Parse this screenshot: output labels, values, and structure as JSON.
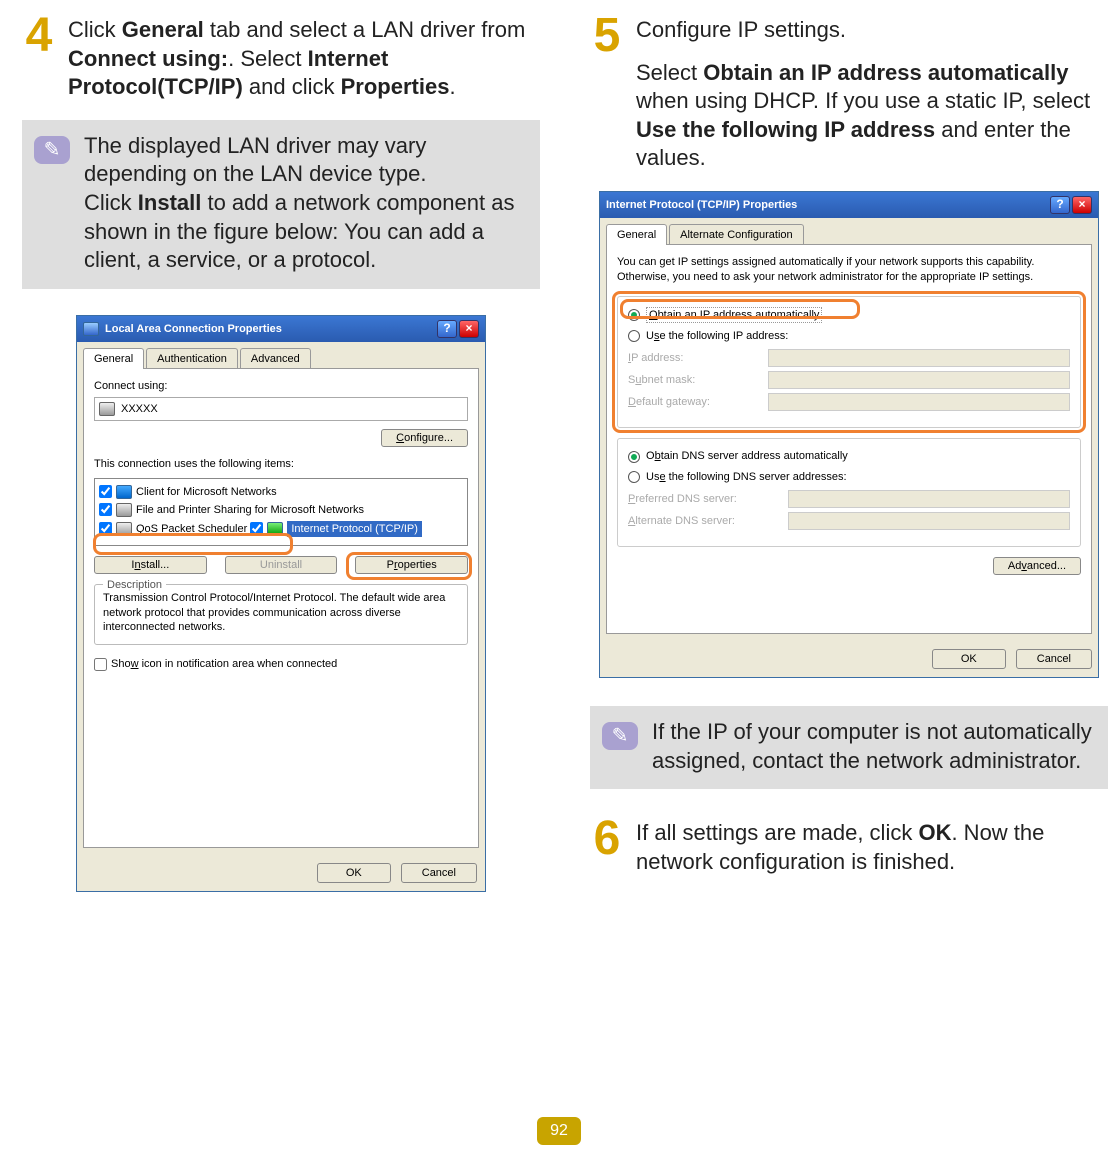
{
  "steps": {
    "s4": {
      "num": "4",
      "text_pre": "Click ",
      "b1": "General",
      "text_mid1": " tab and select a LAN driver from ",
      "b2": "Connect using:",
      "text_mid2": ". Select ",
      "b3": "Internet Protocol(TCP/IP)",
      "text_mid3": " and click ",
      "b4": "Properties",
      "text_end": "."
    },
    "s5": {
      "num": "5",
      "line1": "Configure IP settings.",
      "para_pre": "Select ",
      "b1": "Obtain an IP address automatically",
      "para_mid1": " when using DHCP. If you use a static IP, select ",
      "b2": "Use the following IP address",
      "para_mid2": " and enter the values."
    },
    "s6": {
      "num": "6",
      "text_pre": "If all settings are made, click ",
      "b1": "OK",
      "text_end": ". Now the network configuration is finished."
    }
  },
  "notes": {
    "n1": {
      "p1": "The displayed LAN driver may vary depending on the LAN device type.",
      "p2_pre": "Click ",
      "p2_b": "Install",
      "p2_post": " to add a network component as shown in the figure below: You can add a client, a service, or a protocol."
    },
    "n2": {
      "text": "If the IP of your computer is not automatically assigned, contact the network administrator."
    }
  },
  "dlg1": {
    "title": "Local Area Connection Properties",
    "tabs": {
      "general": "General",
      "auth": "Authentication",
      "adv": "Advanced"
    },
    "connect_using": "Connect using:",
    "adapter": "XXXXX",
    "configure": "Configure...",
    "uses_items": "This connection uses the following items:",
    "items": {
      "i1": "Client for Microsoft Networks",
      "i2": "File and Printer Sharing for Microsoft Networks",
      "i3": "QoS Packet Scheduler",
      "i4": "Internet Protocol (TCP/IP)"
    },
    "install": "Install...",
    "uninstall": "Uninstall",
    "properties": "Properties",
    "desc_label": "Description",
    "desc_text": "Transmission Control Protocol/Internet Protocol. The default wide area network protocol that provides communication across diverse interconnected networks.",
    "show_icon": "Show icon in notification area when connected",
    "ok": "OK",
    "cancel": "Cancel"
  },
  "dlg2": {
    "title": "Internet Protocol (TCP/IP) Properties",
    "tabs": {
      "general": "General",
      "alt": "Alternate Configuration"
    },
    "intro": "You can get IP settings assigned automatically if your network supports this capability. Otherwise, you need to ask your network administrator for the appropriate IP settings.",
    "r_auto_ip": "Obtain an IP address automatically",
    "r_static_ip": "Use the following IP address:",
    "ip_address": "IP address:",
    "subnet": "Subnet mask:",
    "gateway": "Default gateway:",
    "r_auto_dns": "Obtain DNS server address automatically",
    "r_static_dns": "Use the following DNS server addresses:",
    "pref_dns": "Preferred DNS server:",
    "alt_dns": "Alternate DNS server:",
    "advanced": "Advanced...",
    "ok": "OK",
    "cancel": "Cancel"
  },
  "page_number": "92"
}
